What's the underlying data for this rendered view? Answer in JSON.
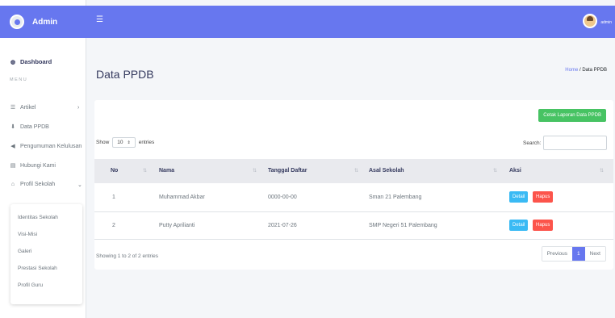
{
  "brand": {
    "title": "Admin"
  },
  "sidebar": {
    "dashboard_label": "Dashboard",
    "menu_header": "MENU",
    "items": [
      {
        "label": "Artikel",
        "icon": "list-icon",
        "has_chevron": true
      },
      {
        "label": "Data PPDB",
        "icon": "download-icon",
        "has_chevron": false
      },
      {
        "label": "Pengumuman Kelulusan",
        "icon": "megaphone-icon",
        "has_chevron": false
      },
      {
        "label": "Hubungi Kami",
        "icon": "contact-card-icon",
        "has_chevron": false
      },
      {
        "label": "Profil Sekolah",
        "icon": "building-icon",
        "has_chevron": true
      }
    ],
    "submenu": [
      "Identitas Sekolah",
      "Visi-Misi",
      "Galeri",
      "Prestasi Sekolah",
      "Profil Guru"
    ]
  },
  "topbar": {
    "hamburger_glyph": "☰",
    "user_name": "admin"
  },
  "page": {
    "title": "Data PPDB",
    "breadcrumb_home": "Home",
    "breadcrumb_sep": "/",
    "breadcrumb_current": "Data PPDB"
  },
  "card": {
    "report_button": "Cetak Laporan Data PPDB",
    "show_label": "Show",
    "entries_value": "10",
    "entries_label": "entries",
    "search_label": "Search:",
    "search_value": "",
    "columns": [
      "No",
      "Nama",
      "Tanggal Daftar",
      "Asal Sekolah",
      "Aksi"
    ],
    "rows": [
      {
        "no": "1",
        "nama": "Muhammad Akbar",
        "tanggal": "0000-00-00",
        "asal": "Sman 21 Palembang"
      },
      {
        "no": "2",
        "nama": "Putty Aprilianti",
        "tanggal": "2021-07-26",
        "asal": "SMP Negeri 51 Palembang"
      }
    ],
    "detail_label": "Detail",
    "hapus_label": "Hapus",
    "info": "Showing 1 to 2 of 2 entries",
    "pager": {
      "previous": "Previous",
      "current": "1",
      "next": "Next"
    }
  },
  "colors": {
    "primary": "#6777ef",
    "success": "#47c363",
    "info": "#3abaf4",
    "danger": "#fc544b"
  }
}
